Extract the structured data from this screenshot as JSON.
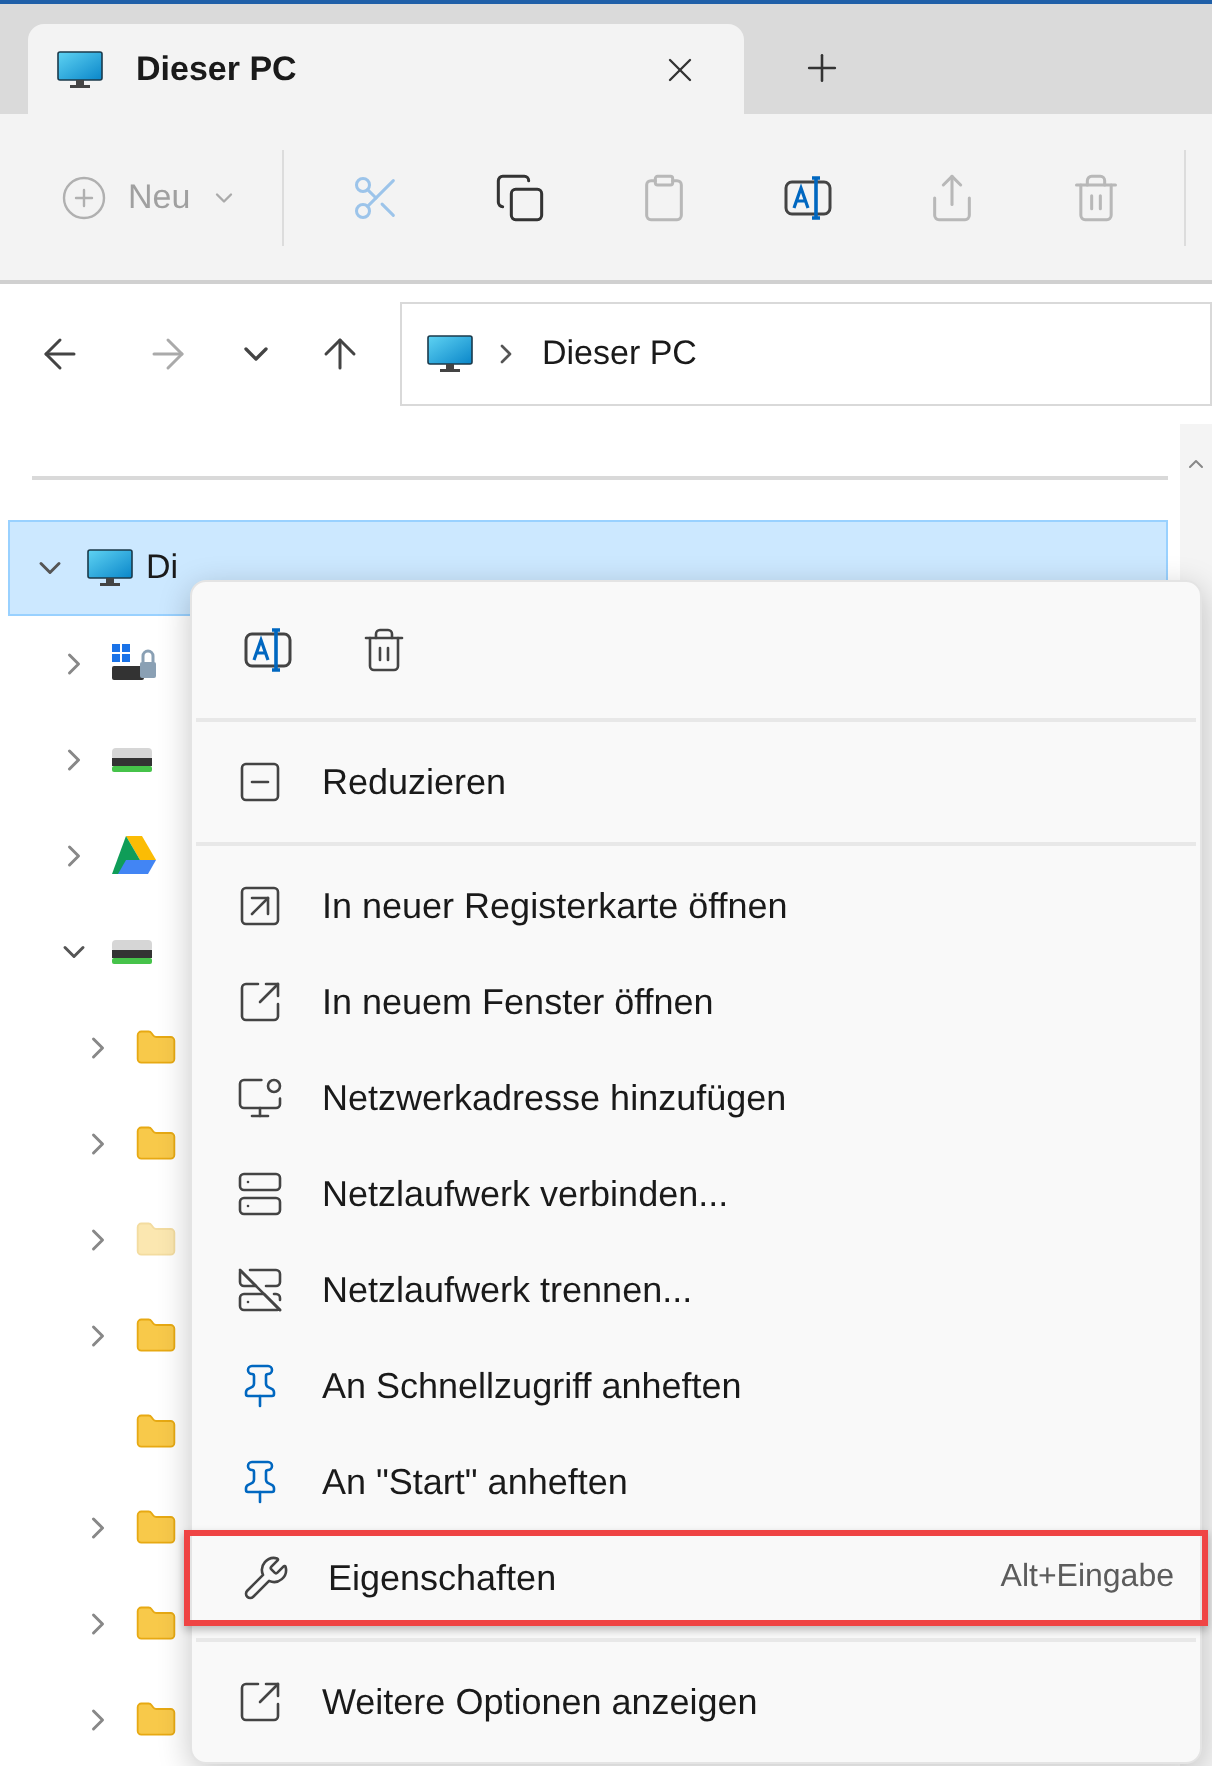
{
  "tab": {
    "title": "Dieser PC",
    "selected": true
  },
  "toolbar": {
    "new_label": "Neu",
    "buttons": [
      {
        "kind": "cut",
        "disabled": true
      },
      {
        "kind": "copy",
        "disabled": false
      },
      {
        "kind": "paste",
        "disabled": true
      },
      {
        "kind": "rename",
        "disabled": false
      },
      {
        "kind": "share",
        "disabled": true
      },
      {
        "kind": "delete",
        "disabled": true
      }
    ]
  },
  "nav": {
    "back_disabled": false,
    "forward_disabled": true
  },
  "address": {
    "crumbs": [
      "Dieser PC"
    ]
  },
  "tree": [
    {
      "kind": "pc",
      "label": "Di",
      "expanded": true,
      "selected": true,
      "children": [
        {
          "kind": "windrive",
          "expanded": false
        },
        {
          "kind": "drive",
          "expanded": false
        },
        {
          "kind": "cloud",
          "expanded": false
        },
        {
          "kind": "drive",
          "expanded": true,
          "children": [
            {
              "kind": "folder",
              "expandable": true,
              "hidden": false
            },
            {
              "kind": "folder",
              "expandable": true,
              "hidden": false
            },
            {
              "kind": "folder",
              "expandable": true,
              "hidden": true
            },
            {
              "kind": "folder",
              "expandable": true,
              "hidden": false
            },
            {
              "kind": "folder",
              "expandable": false,
              "hidden": false
            },
            {
              "kind": "folder",
              "expandable": true,
              "hidden": false
            },
            {
              "kind": "folder",
              "expandable": true,
              "hidden": false
            },
            {
              "kind": "folder",
              "expandable": true,
              "hidden": false
            }
          ]
        }
      ]
    }
  ],
  "context_menu": {
    "top_actions": [
      {
        "kind": "rename"
      },
      {
        "kind": "delete"
      }
    ],
    "groups": [
      [
        {
          "kind": "collapse",
          "label": "Reduzieren",
          "highlighted": false
        }
      ],
      [
        {
          "kind": "tab",
          "label": "In neuer Registerkarte öffnen",
          "highlighted": false
        },
        {
          "kind": "window",
          "label": "In neuem Fenster öffnen",
          "highlighted": false
        },
        {
          "kind": "netaddr",
          "label": "Netzwerkadresse hinzufügen",
          "highlighted": false
        },
        {
          "kind": "mapdrive",
          "label": "Netzlaufwerk verbinden...",
          "highlighted": false
        },
        {
          "kind": "unmap",
          "label": "Netzlaufwerk trennen...",
          "highlighted": false
        },
        {
          "kind": "pin",
          "label": "An Schnellzugriff anheften",
          "highlighted": false
        },
        {
          "kind": "pin",
          "label": "An \"Start\" anheften",
          "highlighted": false
        },
        {
          "kind": "properties",
          "label": "Eigenschaften",
          "shortcut": "Alt+Eingabe",
          "highlighted": true
        }
      ],
      [
        {
          "kind": "more",
          "label": "Weitere Optionen anzeigen",
          "highlighted": false
        }
      ]
    ]
  }
}
